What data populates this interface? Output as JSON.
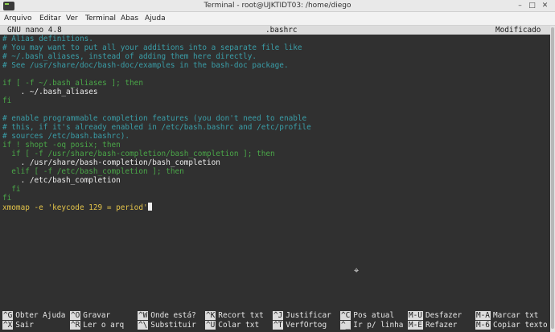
{
  "window": {
    "title": "Terminal - root@UJKTIDT03: /home/diego"
  },
  "menu": [
    "Arquivo",
    "Editar",
    "Ver",
    "Terminal",
    "Abas",
    "Ajuda"
  ],
  "nano": {
    "version": "GNU nano 4.8",
    "filename": ".bashrc",
    "status": "Modificado"
  },
  "lines": [
    "# Alias definitions.",
    "# You may want to put all your additions into a separate file like",
    "# ~/.bash_aliases, instead of adding them here directly.",
    "# See /usr/share/doc/bash-doc/examples in the bash-doc package.",
    "",
    "if [ -f ~/.bash_aliases ]; then",
    "    . ~/.bash_aliases",
    "fi",
    "",
    "# enable programmable completion features (you don't need to enable",
    "# this, if it's already enabled in /etc/bash.bashrc and /etc/profile",
    "# sources /etc/bash.bashrc).",
    "if ! shopt -oq posix; then",
    "  if [ -f /usr/share/bash-completion/bash_completion ]; then",
    "    . /usr/share/bash-completion/bash_completion",
    "  elif [ -f /etc/bash_completion ]; then",
    "    . /etc/bash_completion",
    "  fi",
    "fi",
    "xmomap -e 'keycode 129 = period'"
  ],
  "shortcuts": [
    {
      "key": "^G",
      "label": "Obter Ajuda"
    },
    {
      "key": "^O",
      "label": "Gravar"
    },
    {
      "key": "^W",
      "label": "Onde está?"
    },
    {
      "key": "^K",
      "label": "Recort txt"
    },
    {
      "key": "^J",
      "label": "Justificar"
    },
    {
      "key": "^C",
      "label": "Pos atual"
    },
    {
      "key": "M-U",
      "label": "Desfazer"
    },
    {
      "key": "M-A",
      "label": "Marcar txt"
    },
    {
      "key": "^X",
      "label": "Sair"
    },
    {
      "key": "^R",
      "label": "Ler o arq"
    },
    {
      "key": "^\\",
      "label": "Substituir"
    },
    {
      "key": "^U",
      "label": "Colar txt"
    },
    {
      "key": "^T",
      "label": "VerfOrtog"
    },
    {
      "key": "^_",
      "label": "Ir p/ linha"
    },
    {
      "key": "M-E",
      "label": "Refazer"
    },
    {
      "key": "M-6",
      "label": "Copiar texto"
    }
  ]
}
